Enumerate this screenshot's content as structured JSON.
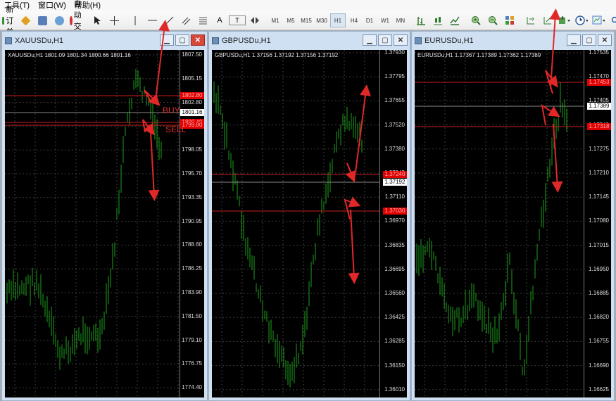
{
  "menu": {
    "items": [
      "工具(T)",
      "窗口(W)",
      "帮助(H)"
    ]
  },
  "toolbar": {
    "new_order": "新订单",
    "auto_trade": "自动交易",
    "text_tool": "A",
    "text_label_tool": "T",
    "timeframes": [
      "M1",
      "M5",
      "M15",
      "M30",
      "H1",
      "H4",
      "D1",
      "W1",
      "MN"
    ],
    "active_timeframe": "H1",
    "alert_count": "1"
  },
  "charts": [
    {
      "title": "XAUUSDu,H1",
      "info": "XAUUSDu,H1  1801.09 1801.34 1800.66 1801.16",
      "ticks": [
        "1807.50",
        "1805.15",
        "1802.80",
        "1800.40",
        "1798.05",
        "1795.70",
        "1793.35",
        "1790.95",
        "1788.60",
        "1786.25",
        "1783.90",
        "1781.50",
        "1779.10",
        "1776.75",
        "1774.40"
      ],
      "price_tags": [
        {
          "text": "1802.80",
          "style": "red",
          "value": 1802.8
        },
        {
          "text": "1801.16",
          "style": "white",
          "value": 1801.16
        },
        {
          "text": "1800.40",
          "style": "red",
          "value": 1800.4
        },
        {
          "text": "1799.80",
          "style": "red",
          "value": 1799.8
        }
      ],
      "labels": {
        "buy": "BUY",
        "sell": "SELL"
      }
    },
    {
      "title": "GBPUSDu,H1",
      "info": "GBPUSDu,H1  1.37156 1.37192 1.37156 1.37192",
      "ticks": [
        "1.37930",
        "1.37795",
        "1.37655",
        "1.37520",
        "1.37380",
        "1.37245",
        "1.37110",
        "1.36970",
        "1.36835",
        "1.36695",
        "1.36560",
        "1.36425",
        "1.36285",
        "1.36150",
        "1.36010"
      ],
      "price_tags": [
        {
          "text": "1.37240",
          "style": "red",
          "value": 1.3724
        },
        {
          "text": "1.37192",
          "style": "white",
          "value": 1.37192
        },
        {
          "text": "1.37030",
          "style": "red",
          "value": 1.3703
        }
      ]
    },
    {
      "title": "EURUSDu,H1",
      "info": "EURUSDu,H1  1.17367 1.17389 1.17362 1.17389",
      "ticks": [
        "1.17535",
        "1.17470",
        "1.17405",
        "1.17340",
        "1.17275",
        "1.17210",
        "1.17145",
        "1.17080",
        "1.17015",
        "1.16950",
        "1.16885",
        "1.16820",
        "1.16755",
        "1.16690",
        "1.16625"
      ],
      "price_tags": [
        {
          "text": "1.17453",
          "style": "red",
          "value": 1.17453
        },
        {
          "text": "1.17389",
          "style": "white",
          "value": 1.17389
        },
        {
          "text": "1.17318",
          "style": "red",
          "value": 1.17318
        }
      ]
    }
  ],
  "colors": {
    "candle": "#1ea01e",
    "level": "#c81e1e",
    "arrow": "#e02828",
    "grid": "#3c3c3c"
  }
}
